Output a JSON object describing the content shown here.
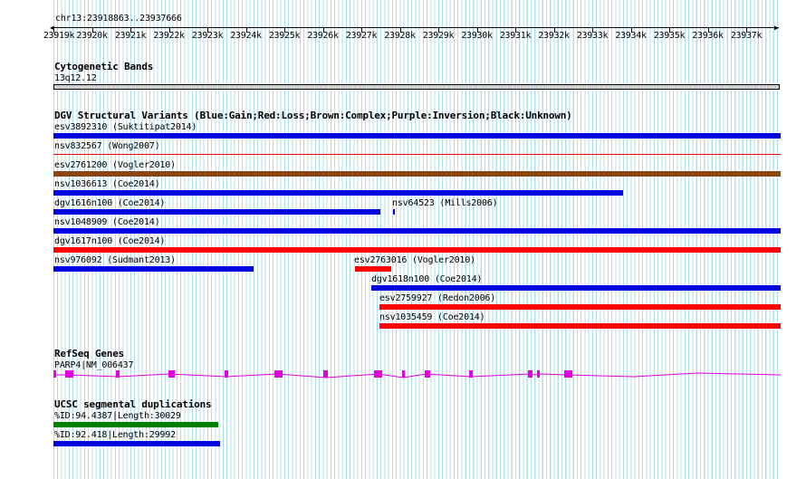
{
  "ruler": {
    "locus": "chr13:23918863..23937666",
    "ticks": [
      "23919k",
      "23920k",
      "23921k",
      "23922k",
      "23923k",
      "23924k",
      "23925k",
      "23926k",
      "23927k",
      "23928k",
      "23929k",
      "23930k",
      "23931k",
      "23932k",
      "23933k",
      "23934k",
      "23935k",
      "23936k",
      "23937k"
    ]
  },
  "cytogenetic": {
    "title": "Cytogenetic Bands",
    "band": "13q12.12",
    "band_color": "#cfcfcf"
  },
  "dgv": {
    "title": "DGV Structural Variants (Blue:Gain;Red:Loss;Brown:Complex;Purple:Inversion;Black:Unknown)",
    "colors": {
      "gain": "#0000e0",
      "loss": "#ff0000",
      "complex": "#8b4513"
    },
    "variants": [
      {
        "label": "esv3892310 (Suktitipat2014)",
        "type": "gain"
      },
      {
        "label": "nsv832567 (Wong2007)",
        "type": "loss"
      },
      {
        "label": "esv2761200 (Vogler2010)",
        "type": "complex"
      },
      {
        "label": "nsv1036613 (Coe2014)",
        "type": "gain"
      },
      {
        "label": "dgv1616n100 (Coe2014)",
        "type": "gain"
      },
      {
        "label": "nsv64523 (Mills2006)",
        "type": "gain"
      },
      {
        "label": "nsv1048909 (Coe2014)",
        "type": "gain"
      },
      {
        "label": "dgv1617n100 (Coe2014)",
        "type": "loss"
      },
      {
        "label": "nsv976092 (Sudmant2013)",
        "type": "gain"
      },
      {
        "label": "esv2763016 (Vogler2010)",
        "type": "loss"
      },
      {
        "label": "dgv1618n100 (Coe2014)",
        "type": "gain"
      },
      {
        "label": "esv2759927 (Redon2006)",
        "type": "loss"
      },
      {
        "label": "nsv1035459 (Coe2014)",
        "type": "loss"
      }
    ]
  },
  "refseq": {
    "title": "RefSeq Genes",
    "gene_label": "PARP4|NM_006437",
    "gene_color": "#e000e0"
  },
  "segdups": {
    "title": "UCSC segmental duplications",
    "items": [
      {
        "label": "%ID:94.4387|Length:30029",
        "color": "#008000"
      },
      {
        "label": "%ID:92.418|Length:29992",
        "color": "#0000e0"
      }
    ]
  }
}
